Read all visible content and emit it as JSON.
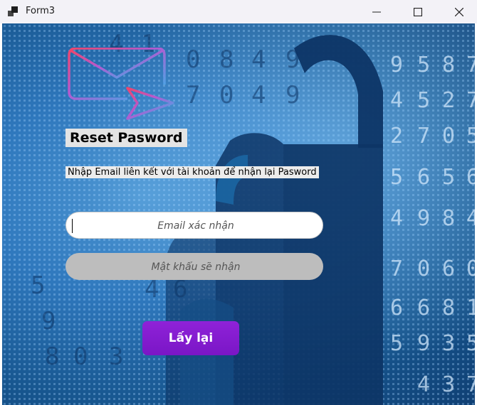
{
  "window": {
    "title": "Form3",
    "icons": {
      "app": "app-form-icon",
      "minimize": "minimize-icon",
      "maximize": "maximize-icon",
      "close": "close-icon"
    }
  },
  "form": {
    "logo_icon": "mail-send-icon",
    "heading": "Reset Pasword",
    "description": "Nhập Email liên kết với tài khoản để nhận lại Pasword",
    "email_input": {
      "placeholder": "Email xác nhận",
      "value": ""
    },
    "password_input": {
      "placeholder": "Mật khẩu sẽ nhận",
      "value": ""
    },
    "submit_label": "Lấy lại"
  },
  "background": {
    "description_icon": "padlock-icon",
    "colors": {
      "primary": "#2f78bd",
      "dark": "#0f3f73",
      "lock": "#0d3566",
      "button": "#8f22d8"
    }
  }
}
